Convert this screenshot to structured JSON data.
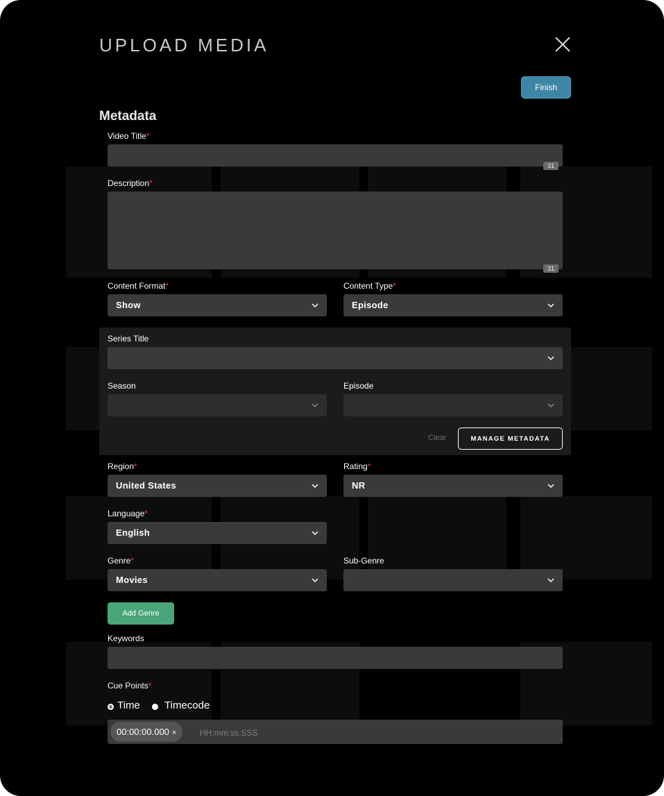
{
  "modal": {
    "title": "UPLOAD MEDIA",
    "finish_label": "Finish",
    "section_heading": "Metadata"
  },
  "required_mark": "*",
  "fields": {
    "video_title": {
      "label": "Video Title",
      "value": "",
      "counter": "31"
    },
    "description": {
      "label": "Description",
      "value": "",
      "counter": "31"
    },
    "content_format": {
      "label": "Content Format",
      "value": "Show"
    },
    "content_type": {
      "label": "Content Type",
      "value": "Episode"
    },
    "series_title": {
      "label": "Series Title",
      "value": ""
    },
    "season": {
      "label": "Season",
      "value": ""
    },
    "episode": {
      "label": "Episode",
      "value": ""
    },
    "region": {
      "label": "Region",
      "value": "United States"
    },
    "rating": {
      "label": "Rating",
      "value": "NR"
    },
    "language": {
      "label": "Language",
      "value": "English"
    },
    "genre": {
      "label": "Genre",
      "value": "Movies"
    },
    "sub_genre": {
      "label": "Sub-Genre",
      "value": ""
    },
    "keywords": {
      "label": "Keywords",
      "value": ""
    },
    "cue_points": {
      "label": "Cue Points",
      "mode_time_label": "Time",
      "mode_timecode_label": "Timecode",
      "selected_mode": "Time",
      "chip_value": "00:00:00.000",
      "chip_remove": "×",
      "placeholder": "HH:mm:ss.SSS"
    }
  },
  "series_actions": {
    "clear_label": "Clear",
    "manage_label": "MANAGE METADATA"
  },
  "add_genre_label": "Add Genre",
  "colors": {
    "accent_blue": "#3e86a6",
    "accent_green": "#4aa679",
    "required_red": "#e0414d",
    "field_bg": "#3a3a3a"
  },
  "icons": [
    "close-icon",
    "chevron-down-icon"
  ]
}
